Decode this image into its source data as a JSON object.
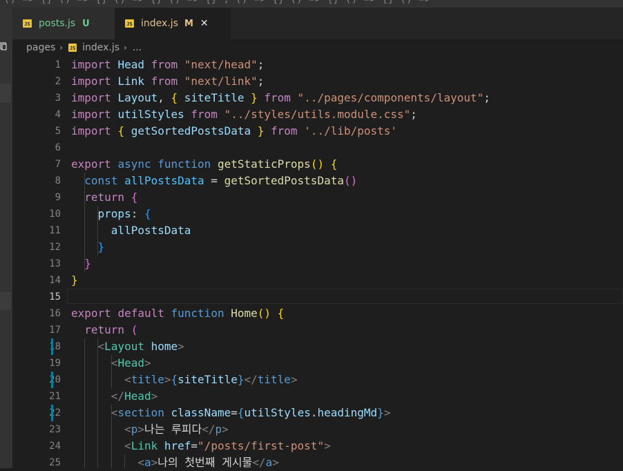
{
  "top_strip": {
    "fragment": "() => {} () => {} () => {} () => {} ; () => {} () => {} () => {} () =>"
  },
  "tabs": [
    {
      "badge": "JS",
      "name": "posts.js",
      "status": "U"
    },
    {
      "badge": "JS",
      "name": "index.js",
      "status": "M",
      "close": "✕"
    }
  ],
  "breadcrumb": {
    "folder": "pages",
    "separator": "›",
    "badge": "JS",
    "file": "index.js",
    "ellipsis": "..."
  },
  "editor": {
    "current_line": 15,
    "line_numbers": [
      "1",
      "2",
      "3",
      "4",
      "5",
      "6",
      "7",
      "8",
      "9",
      "10",
      "11",
      "12",
      "13",
      "14",
      "15",
      "16",
      "17",
      "18",
      "19",
      "20",
      "21",
      "22",
      "23",
      "24",
      "25"
    ],
    "code": {
      "l1": [
        "import",
        " ",
        "Head",
        " ",
        "from",
        " ",
        "\"next/head\"",
        ";"
      ],
      "l2": [
        "import",
        " ",
        "Link",
        " ",
        "from",
        " ",
        "\"next/link\"",
        ";"
      ],
      "l3": [
        "import",
        " ",
        "Layout",
        ", ",
        "{",
        " ",
        "siteTitle",
        " ",
        "}",
        " ",
        "from",
        " ",
        "\"../pages/components/layout\"",
        ";"
      ],
      "l4": [
        "import",
        " ",
        "utilStyles",
        " ",
        "from",
        " ",
        "\"../styles/utils.module.css\"",
        ";"
      ],
      "l5": [
        "import",
        " ",
        "{",
        " ",
        "getSortedPostsData",
        " ",
        "}",
        " ",
        "from",
        " ",
        "'../lib/posts'"
      ],
      "l7": [
        "export",
        " ",
        "async",
        " ",
        "function",
        " ",
        "getStaticProps",
        "()",
        " ",
        "{"
      ],
      "l8": [
        "  ",
        "const",
        " ",
        "allPostsData",
        " = ",
        "getSortedPostsData",
        "()"
      ],
      "l9": [
        "  ",
        "return",
        " ",
        "{"
      ],
      "l10": [
        "    ",
        "props",
        ": ",
        "{"
      ],
      "l11": [
        "      ",
        "allPostsData"
      ],
      "l12": [
        "    ",
        "}"
      ],
      "l13": [
        "  ",
        "}"
      ],
      "l14": [
        "}"
      ],
      "l16": [
        "export",
        " ",
        "default",
        " ",
        "function",
        " ",
        "Home",
        "()",
        " ",
        "{"
      ],
      "l17": [
        "  ",
        "return",
        " ",
        "("
      ],
      "l18": [
        "    ",
        "<",
        "Layout",
        " ",
        "home",
        ">"
      ],
      "l19": [
        "      ",
        "<",
        "Head",
        ">"
      ],
      "l20": [
        "        ",
        "<",
        "title",
        ">",
        "{",
        "siteTitle",
        "}",
        "</",
        "title",
        ">"
      ],
      "l21": [
        "      ",
        "</",
        "Head",
        ">"
      ],
      "l22": [
        "      ",
        "<",
        "section",
        " ",
        "className",
        "=",
        "{",
        "utilStyles",
        ".",
        "headingMd",
        "}",
        ">"
      ],
      "l23": [
        "        ",
        "<",
        "p",
        ">",
        "나는 루피다",
        "</",
        "p",
        ">"
      ],
      "l24": [
        "        ",
        "<",
        "Link",
        " ",
        "href",
        "=",
        "\"/posts/first-post\"",
        ">"
      ],
      "l25": [
        "          ",
        "<",
        "a",
        ">",
        "나의 첫번째 게시물",
        "</",
        "a",
        ">"
      ]
    }
  },
  "colors": {
    "background": "#1e1e1e",
    "keyword": "#c586c0",
    "string": "#ce9178",
    "variable": "#9cdcfe",
    "function": "#dcdcaa",
    "storage": "#569cd6",
    "component": "#4ec9b0",
    "gutter_modified": "#0c7d9d"
  }
}
